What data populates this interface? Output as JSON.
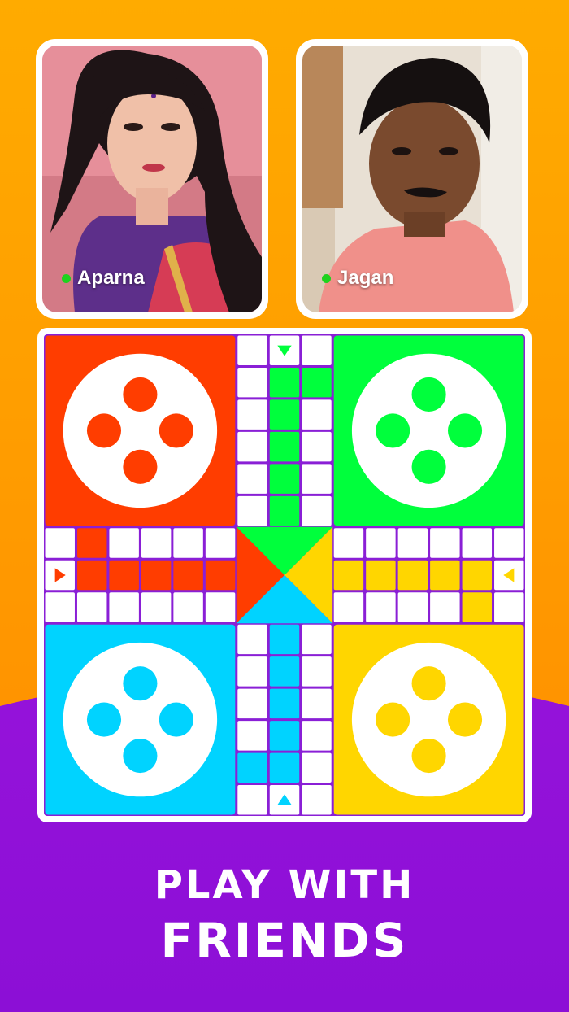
{
  "players": [
    {
      "name": "Aparna",
      "status": "online"
    },
    {
      "name": "Jagan",
      "status": "online"
    }
  ],
  "tagline": {
    "line1": "PLAY WITH",
    "line2": "FRIENDS"
  },
  "colors": {
    "background_top": "#ff9f00",
    "background_bottom": "#9f16de",
    "board_grid": "#8a1fd6",
    "red": "#ff3d00",
    "green": "#00ff3c",
    "blue": "#00d3ff",
    "yellow": "#ffd600",
    "online": "#1ed21e"
  },
  "board": {
    "homes": [
      "red",
      "green",
      "blue",
      "yellow"
    ],
    "tokens_per_home": 4
  }
}
